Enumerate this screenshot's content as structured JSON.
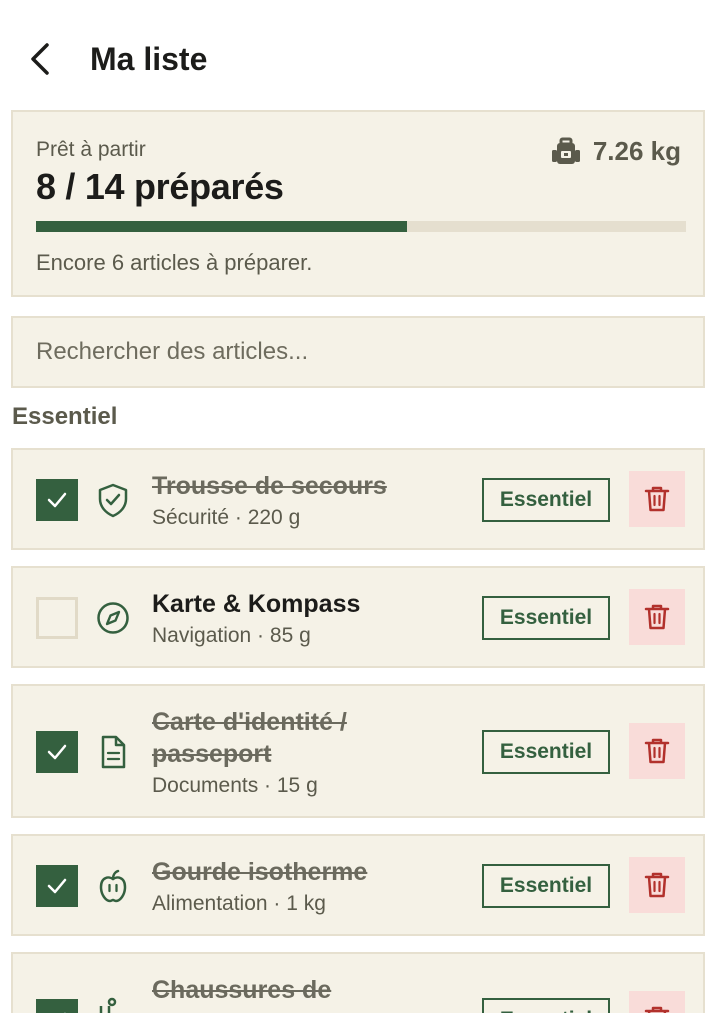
{
  "header": {
    "title": "Ma liste"
  },
  "summary": {
    "subtitle": "Prêt à partir",
    "count_text": "8 / 14 préparés",
    "weight": "7.26 kg",
    "progress": 0.571,
    "remaining_text": "Encore 6 articles à préparer."
  },
  "search": {
    "placeholder": "Rechercher des articles..."
  },
  "section": {
    "title": "Essentiel"
  },
  "items": [
    {
      "name": "Trousse de secours",
      "meta": "Sécurité · 220 g",
      "badge": "Essentiel",
      "checked": true,
      "icon": "shield-check-icon"
    },
    {
      "name": "Karte & Kompass",
      "meta": "Navigation · 85 g",
      "badge": "Essentiel",
      "checked": false,
      "icon": "compass-icon"
    },
    {
      "name": "Carte d'identité / passeport",
      "meta": "Documents · 15 g",
      "badge": "Essentiel",
      "checked": true,
      "icon": "document-icon"
    },
    {
      "name": "Gourde isotherme",
      "meta": "Alimentation · 1 kg",
      "badge": "Essentiel",
      "checked": true,
      "icon": "apple-icon"
    },
    {
      "name": "Chaussures de",
      "meta": "",
      "badge": "Essentiel",
      "checked": true,
      "icon": "boot-icon"
    }
  ],
  "colors": {
    "accent": "#34603f",
    "card_background": "#f5f2e7",
    "card_border": "#e6e0cf",
    "delete_background": "#f9dcd9",
    "delete_icon": "#b2312c"
  }
}
